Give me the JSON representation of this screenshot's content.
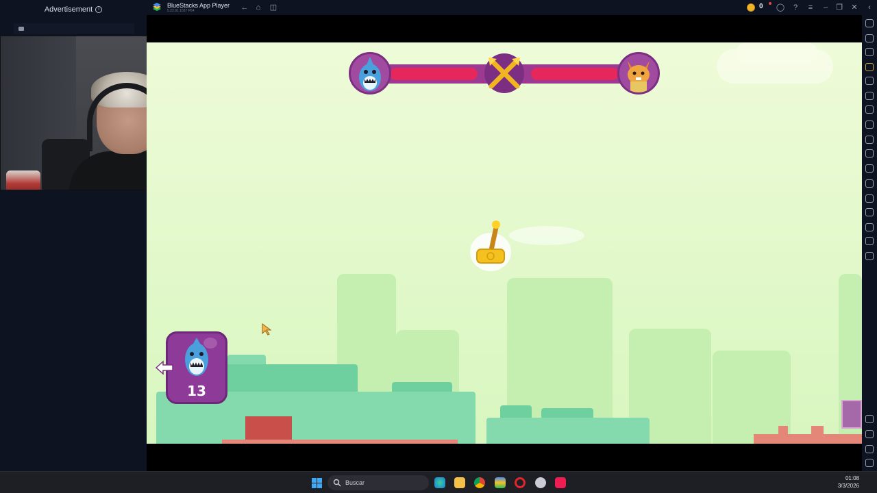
{
  "ad_panel": {
    "label": "Advertisement"
  },
  "titlebar": {
    "app_name": "BlueStacks App Player",
    "version": "5.22.91.1037 P64",
    "coin_count": "0",
    "icons": [
      "back-icon",
      "home-icon",
      "multi-instance-icon",
      "coin-icon",
      "account-icon",
      "help-icon",
      "menu-icon",
      "minimize-icon",
      "restore-icon",
      "close-icon",
      "collapse-icon"
    ]
  },
  "sidebar_tools": [
    "fullscreen-icon",
    "volume-icon",
    "media-icon",
    "keyboard-icon",
    "macro-icon",
    "sync-icon",
    "rotate-icon",
    "performance-icon",
    "screenshot-icon",
    "record-icon",
    "gallery-icon",
    "install-apk-icon",
    "folder-icon",
    "eco-mode-icon",
    "location-icon",
    "layers-icon",
    "replay-icon",
    "settings-icon",
    "back-icon",
    "home-icon",
    "recent-apps-icon"
  ],
  "game": {
    "hp_left": 0.8,
    "hp_right": 0.8,
    "player_card_value": "13",
    "player_left_avatar": "shark-icon",
    "player_right_avatar": "cat-warrior-icon",
    "center_icon": "crossed-swords-icon",
    "projectile": "hammer-icon"
  },
  "taskbar": {
    "search_placeholder": "Buscar",
    "time": "01:08",
    "date": "3/3/2026",
    "apps": [
      "edge-icon",
      "file-explorer-icon",
      "chrome-icon",
      "bluestacks-icon",
      "opera-icon",
      "steam-icon",
      "tiktok-icon"
    ]
  },
  "colors": {
    "sky": "#dcf7c3",
    "hp_fill": "#e5275c",
    "card_purple": "#8d3a98",
    "building_green": "#84d9ad"
  }
}
